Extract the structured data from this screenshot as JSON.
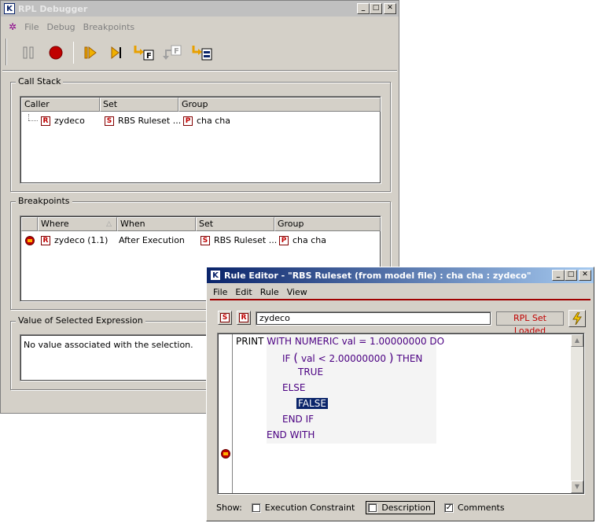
{
  "debugger": {
    "title": "RPL Debugger",
    "menu": [
      "File",
      "Debug",
      "Breakpoints"
    ],
    "toolbar_icons": [
      "pause-icon",
      "stop-icon",
      "continue-icon",
      "step-icon",
      "step-into-function-icon",
      "step-out-function-icon",
      "step-into-set-icon"
    ],
    "call_stack": {
      "label": "Call Stack",
      "columns": [
        "Caller",
        "Set",
        "Group"
      ],
      "rows": [
        {
          "caller": "zydeco",
          "caller_icon": "R",
          "set": "RBS Ruleset ...",
          "set_icon": "S",
          "group": "cha cha",
          "group_icon": "P"
        }
      ]
    },
    "breakpoints": {
      "label": "Breakpoints",
      "columns": [
        "Where",
        "When",
        "Set",
        "Group"
      ],
      "rows": [
        {
          "where": "zydeco (1.1)",
          "where_icon": "R",
          "when": "After Execution",
          "set": "RBS Ruleset ...",
          "set_icon": "S",
          "group": "cha cha",
          "group_icon": "P"
        }
      ]
    },
    "value_panel": {
      "label": "Value of Selected Expression",
      "text": "No value associated with the selection."
    }
  },
  "editor": {
    "title": "Rule Editor - \"RBS Ruleset (from model file) : cha cha : zydeco\"",
    "menu": [
      "File",
      "Edit",
      "Rule",
      "View"
    ],
    "set_icon": "S",
    "rule_icon": "R",
    "rule_name": "zydeco",
    "status": "RPL Set Loaded",
    "code": {
      "print": "PRINT",
      "line1": "WITH NUMERIC val = 1.00000000 DO",
      "if_kw": "IF",
      "lparen": "(",
      "cond": "val < 2.00000000",
      "rparen": ")",
      "then_kw": "THEN",
      "true_kw": "TRUE",
      "else_kw": "ELSE",
      "false_kw": "FALSE",
      "endif_kw": "END IF",
      "endwith_kw": "END WITH"
    },
    "show_label": "Show:",
    "checkboxes": [
      {
        "label": "Execution Constraint",
        "checked": false
      },
      {
        "label": "Description",
        "checked": false
      },
      {
        "label": "Comments",
        "checked": true
      }
    ]
  }
}
